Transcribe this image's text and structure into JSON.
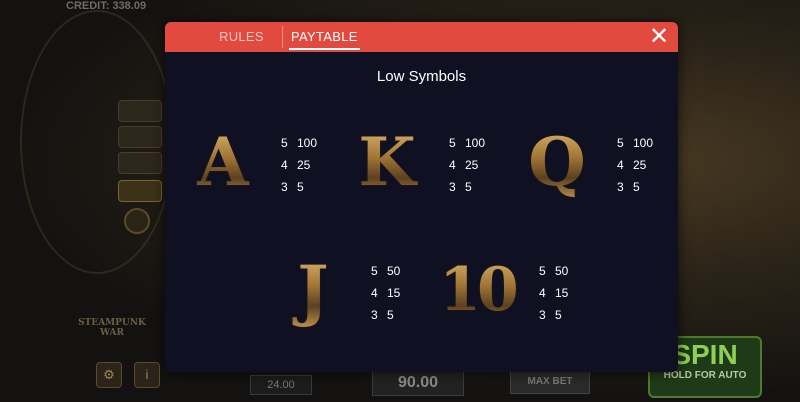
{
  "background": {
    "credit": "CREDIT: 338.09",
    "logo": "STEAMPUNK WAR",
    "bet_value": "24.00",
    "total_value": "90.00",
    "max_bet_label": "MAX BET",
    "spin_label": "SPIN",
    "hold_label": "HOLD FOR AUTO",
    "settings_icon": "gear-icon",
    "info_icon": "info-icon"
  },
  "modal": {
    "tabs": [
      {
        "label": "RULES",
        "active": false
      },
      {
        "label": "PAYTABLE",
        "active": true
      }
    ],
    "close_icon": "close-icon",
    "section_title": "Low Symbols",
    "symbols": [
      {
        "symbol": "A",
        "payouts": [
          {
            "count": "5",
            "value": "100"
          },
          {
            "count": "4",
            "value": "25"
          },
          {
            "count": "3",
            "value": "5"
          }
        ]
      },
      {
        "symbol": "K",
        "payouts": [
          {
            "count": "5",
            "value": "100"
          },
          {
            "count": "4",
            "value": "25"
          },
          {
            "count": "3",
            "value": "5"
          }
        ]
      },
      {
        "symbol": "Q",
        "payouts": [
          {
            "count": "5",
            "value": "100"
          },
          {
            "count": "4",
            "value": "25"
          },
          {
            "count": "3",
            "value": "5"
          }
        ]
      },
      {
        "symbol": "J",
        "payouts": [
          {
            "count": "5",
            "value": "50"
          },
          {
            "count": "4",
            "value": "15"
          },
          {
            "count": "3",
            "value": "5"
          }
        ]
      },
      {
        "symbol": "10",
        "payouts": [
          {
            "count": "5",
            "value": "50"
          },
          {
            "count": "4",
            "value": "15"
          },
          {
            "count": "3",
            "value": "5"
          }
        ]
      }
    ]
  },
  "colors": {
    "header_red": "#e2493f",
    "modal_bg": "#0f1022",
    "symbol_gold": "#b88f48"
  }
}
